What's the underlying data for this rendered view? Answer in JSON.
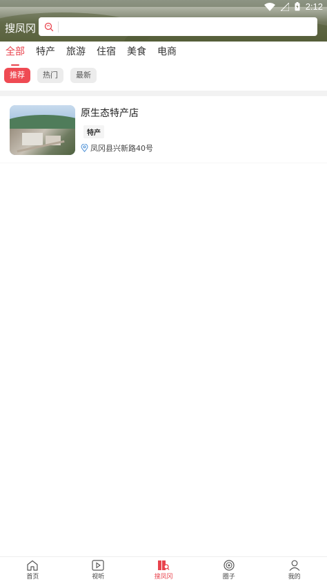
{
  "status_bar": {
    "time": "2:12"
  },
  "header": {
    "brand": "搜凤冈",
    "search": {
      "placeholder": "",
      "value": ""
    }
  },
  "tabs": [
    {
      "label": "全部",
      "active": true
    },
    {
      "label": "特产",
      "active": false
    },
    {
      "label": "旅游",
      "active": false
    },
    {
      "label": "住宿",
      "active": false
    },
    {
      "label": "美食",
      "active": false
    },
    {
      "label": "电商",
      "active": false
    }
  ],
  "chips": [
    {
      "label": "推荐",
      "active": true
    },
    {
      "label": "热门",
      "active": false
    },
    {
      "label": "最新",
      "active": false
    }
  ],
  "listings": [
    {
      "title": "原生态特产店",
      "tag": "特产",
      "address": "凤冈县兴新路40号"
    }
  ],
  "bottom_nav": [
    {
      "label": "首页",
      "icon": "home-icon",
      "active": false
    },
    {
      "label": "视听",
      "icon": "play-icon",
      "active": false
    },
    {
      "label": "搜凤冈",
      "icon": "book-search-icon",
      "active": true
    },
    {
      "label": "圈子",
      "icon": "circle-icon",
      "active": false
    },
    {
      "label": "我的",
      "icon": "user-icon",
      "active": false
    }
  ],
  "colors": {
    "accent": "#e8434d",
    "chip_bg": "#ececec"
  }
}
